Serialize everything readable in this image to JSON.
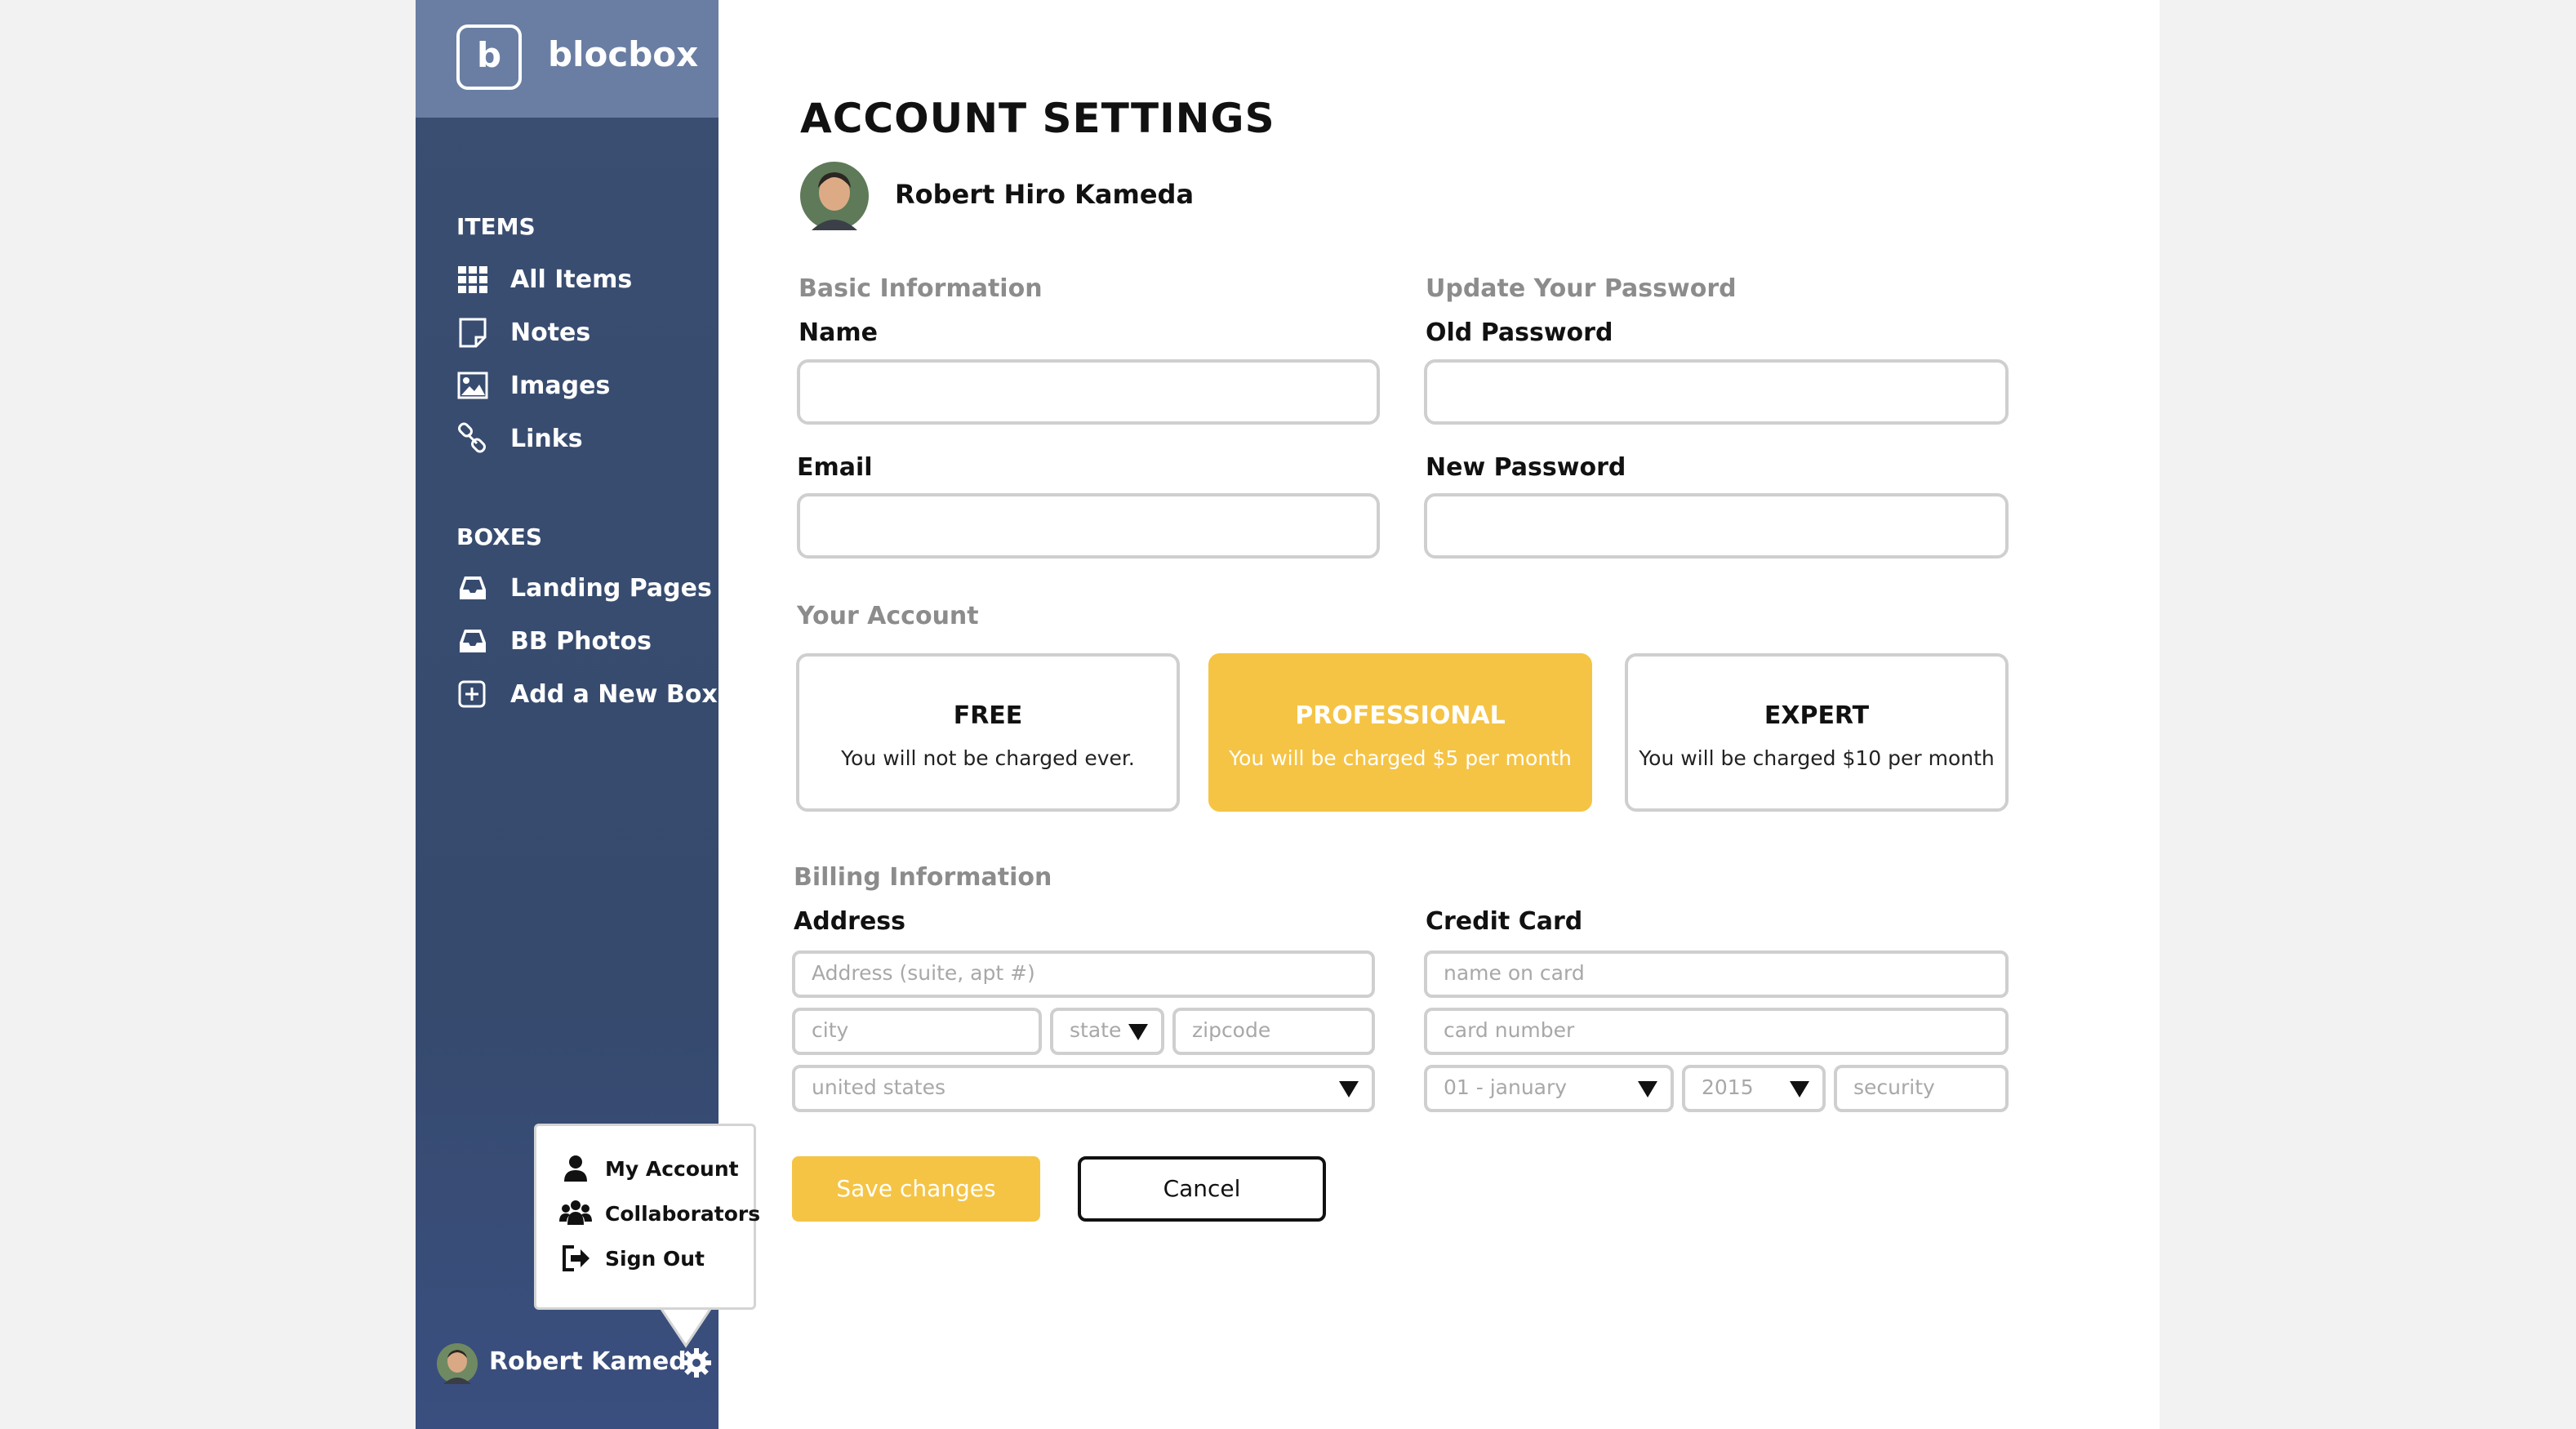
{
  "brand": {
    "logo_letter": "b",
    "name": "blocbox"
  },
  "sidebar": {
    "items_heading": "ITEMS",
    "items": [
      {
        "label": "All Items",
        "icon": "grid-icon"
      },
      {
        "label": "Notes",
        "icon": "note-icon"
      },
      {
        "label": "Images",
        "icon": "image-icon"
      },
      {
        "label": "Links",
        "icon": "link-icon"
      }
    ],
    "boxes_heading": "BOXES",
    "boxes": [
      {
        "label": "Landing Pages",
        "icon": "inbox-icon"
      },
      {
        "label": "BB Photos",
        "icon": "inbox-icon"
      },
      {
        "label": "Add a New Box",
        "icon": "plus-square-icon"
      }
    ],
    "user": {
      "name": "Robert Kameda"
    }
  },
  "user_menu": {
    "items": [
      {
        "label": "My Account",
        "icon": "user-icon"
      },
      {
        "label": "Collaborators",
        "icon": "users-icon"
      },
      {
        "label": "Sign Out",
        "icon": "sign-out-icon"
      }
    ]
  },
  "page": {
    "title": "ACCOUNT SETTINGS",
    "profile_name": "Robert Hiro Kameda"
  },
  "basic_info": {
    "section_title": "Basic Information",
    "name_label": "Name",
    "email_label": "Email"
  },
  "password": {
    "section_title": "Update Your Password",
    "old_label": "Old Password",
    "new_label": "New Password"
  },
  "account": {
    "section_title": "Your Account",
    "plans": [
      {
        "name": "FREE",
        "desc": "You will not be charged ever.",
        "selected": false
      },
      {
        "name": "PROFESSIONAL",
        "desc": "You will be charged $5 per month",
        "selected": true
      },
      {
        "name": "EXPERT",
        "desc": "You will be charged $10 per month",
        "selected": false
      }
    ]
  },
  "billing": {
    "section_title": "Billing Information",
    "address_label": "Address",
    "address_placeholder": "Address (suite, apt #)",
    "city_placeholder": "city",
    "state_placeholder": "state",
    "zip_placeholder": "zipcode",
    "country_value": "united states",
    "card_label": "Credit Card",
    "card_name_placeholder": "name on card",
    "card_number_placeholder": "card number",
    "month_value": "01 - january",
    "year_value": "2015",
    "security_placeholder": "security"
  },
  "actions": {
    "save_label": "Save changes",
    "cancel_label": "Cancel"
  },
  "colors": {
    "sidebar": "#364a6e",
    "brand_bar": "#6a7ea3",
    "accent": "#f5c445",
    "input_border": "#cfcfcf"
  }
}
